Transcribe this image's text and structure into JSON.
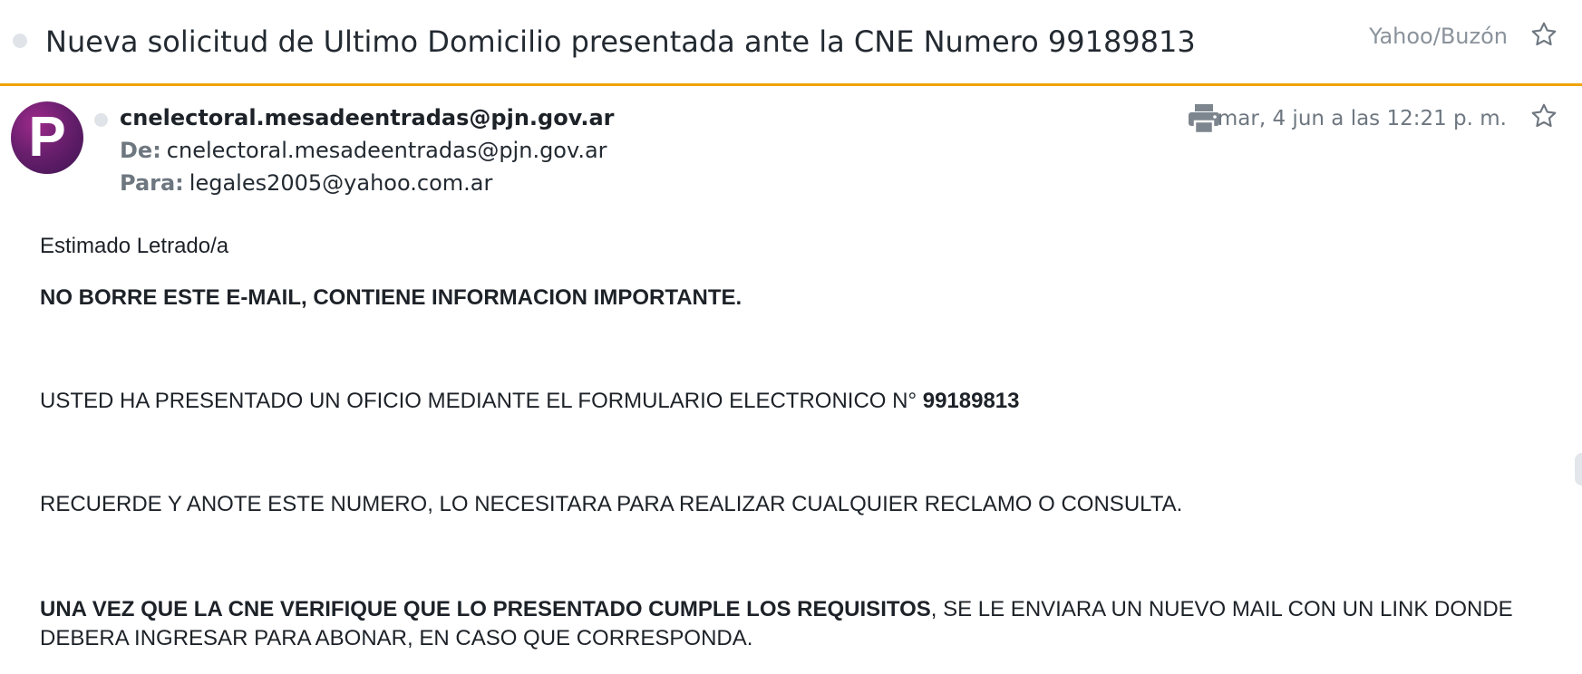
{
  "header": {
    "subject": "Nueva solicitud de Ultimo Domicilio presentada ante la CNE Numero 99189813",
    "folder": "Yahoo/Buzón",
    "star_icon": "star-outline-icon"
  },
  "message": {
    "avatar_letter": "P",
    "sender_name": "cnelectoral.mesadeentradas@pjn.gov.ar",
    "from_label": "De:",
    "from_value": "cnelectoral.mesadeentradas@pjn.gov.ar",
    "to_label": "Para:",
    "to_value": "legales2005@yahoo.com.ar",
    "date": "mar, 4 jun a las 12:21 p. m.",
    "print_icon": "printer-icon"
  },
  "body": {
    "greeting": "Estimado Letrado/a",
    "warning": "NO BORRE ESTE E-MAIL, CONTIENE INFORMACION IMPORTANTE.",
    "line1_text": "USTED HA PRESENTADO UN OFICIO MEDIANTE EL FORMULARIO ELECTRONICO N° ",
    "line1_number": "99189813",
    "line2": "RECUERDE Y ANOTE ESTE NUMERO, LO NECESITARA PARA REALIZAR CUALQUIER RECLAMO O CONSULTA.",
    "line3_bold": "UNA VEZ QUE LA CNE VERIFIQUE QUE LO PRESENTADO CUMPLE LOS REQUISITOS",
    "line3_rest": ", SE LE ENVIARA UN NUEVO MAIL CON UN LINK DONDE DEBERA INGRESAR PARA ABONAR, EN CASO QUE CORRESPONDA."
  },
  "colors": {
    "accent": "#f0a30a",
    "avatar": "#6a1f6e",
    "muted": "#6e7780"
  }
}
